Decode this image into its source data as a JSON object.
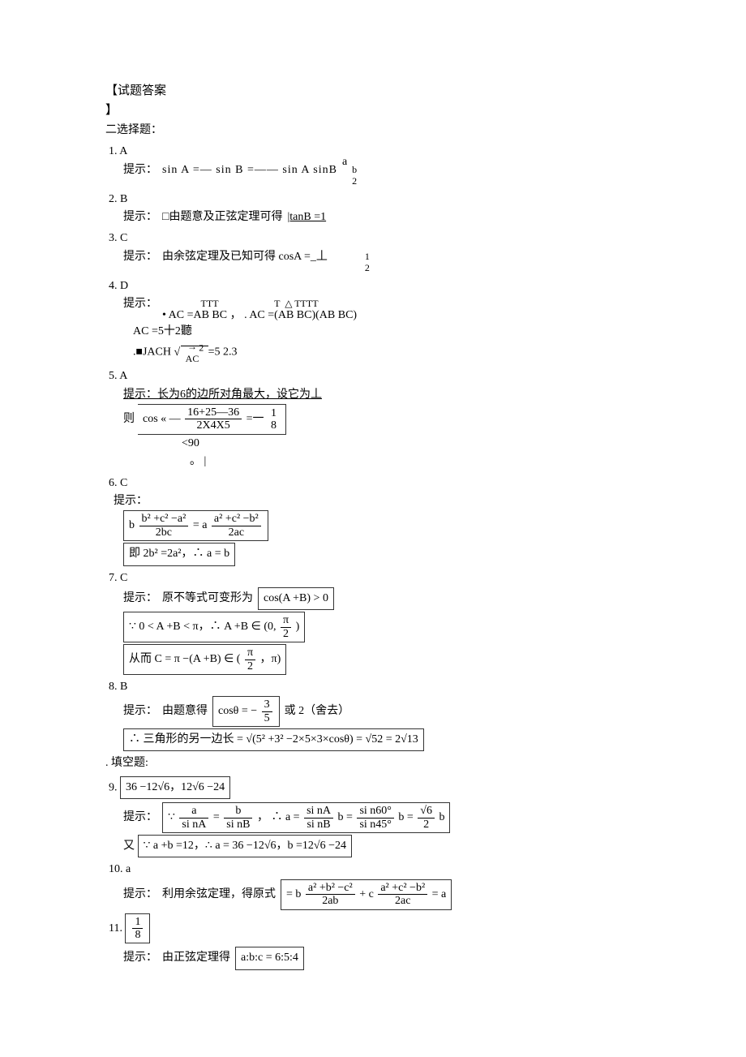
{
  "title1": "【试题答案",
  "title2": "】",
  "section_choice": "二选择题：",
  "q1": {
    "num": "1. A",
    "hint_label": "提示：",
    "expr": "sin A =— sin B =—— sin A sinB",
    "mid_a": "a",
    "frac_b2": "b\n2"
  },
  "q2": {
    "num": "2. B",
    "hint_label": "提示：",
    "text": "□由题意及正弦定理可得",
    "boxed": "|tanB =1"
  },
  "q3": {
    "num": "3. C",
    "hint_label": "提示：",
    "text": "由余弦定理及已知可得 cosA =_丄",
    "top": "1",
    "bot": "2"
  },
  "q4": {
    "num": "4. D",
    "hint_label": "提示：",
    "row1": "TTT                       T  △ TTTT",
    "row2": "• AC =AB BC ， . AC =(AB BC)(AB BC)",
    "row3": "AC =5十2聽",
    "row4a": ".■JACH ",
    "row4b_inner": "→\nAC",
    "row4b_sup": "2",
    "row4c": " =5 2.3"
  },
  "q5": {
    "num": "5. A",
    "hint_row": "提示：长为6的边所对角最大，设它为丄",
    "pre": "则",
    "cos_lhs": "cos « —",
    "num_top": "16+25—36",
    "den_bot": "2X4X5",
    "eq": "=一",
    "rhs_top": "1",
    "rhs_bot": "8",
    "below1": "<90",
    "below2": "。"
  },
  "q6": {
    "num": "6. C",
    "hint_label": "提示：",
    "b1_pre": "b ",
    "b1_num": "b² +c² −a²",
    "b1_den": "2bc",
    "b1_mid": " = a ",
    "b1_num2": "a² +c² −b²",
    "b1_den2": "2ac",
    "b2": "即 2b² =2a²，∴ a = b"
  },
  "q7": {
    "num": "7. C",
    "hint_label": "提示：",
    "text": "原不等式可变形为",
    "box1": "cos(A +B) > 0",
    "box2_a": "∵ 0 < A +B < π，∴ A +B ∈ (0,  ",
    "box2_frac_num": "π",
    "box2_frac_den": "2",
    "box2_b": ")",
    "box3_a": "从而 C = π −(A +B) ∈ (",
    "box3_frac_num": "π",
    "box3_frac_den": "2",
    "box3_b": "，π)"
  },
  "q8": {
    "num": "8. B",
    "hint_label": "提示：",
    "text": "由题意得",
    "box1_a": "cosθ = −",
    "box1_num": "3",
    "box1_den": "5",
    "tail1": "或 2（舍去）",
    "box2": "∴ 三角形的另一边长   = √(5² +3² −2×5×3×cosθ) = √52 = 2√13"
  },
  "section_fill": ". 填空题:",
  "q9": {
    "num": "9.",
    "ans": "36 −12√6，12√6 −24",
    "hint_label": "提示：",
    "box1_a": "∵ ",
    "f1_num": "a",
    "f1_den": "si nA",
    "mid": " = ",
    "f2_num": "b",
    "f2_den": "si nB",
    "comma": "， ∴ a = ",
    "f3_num": "si nA",
    "f3_den": "si nB",
    "b_suffix": " b = ",
    "f4_num": "si n60°",
    "f4_den": "si n45°",
    "b2_suffix": " b = ",
    "f5_num": "√6",
    "f5_den": "2",
    "tail": " b",
    "row2_pre": "又",
    "row2_box": "∵ a +b =12，∴ a = 36 −12√6，b =12√6 −24"
  },
  "q10": {
    "num": "10. a",
    "hint_label": "提示：",
    "text": "利用余弦定理，得原式",
    "box_a": "= b ",
    "f1_num": "a² +b² −c²",
    "f1_den": "2ab",
    "mid": " + c ",
    "f2_num": "a² +c² −b²",
    "f2_den": "2ac",
    "tail": " = a"
  },
  "q11": {
    "num": "11.",
    "ans_num": "1",
    "ans_den": "8",
    "hint_label": "提示：",
    "text": "由正弦定理得",
    "box": "a:b:c = 6:5:4"
  }
}
